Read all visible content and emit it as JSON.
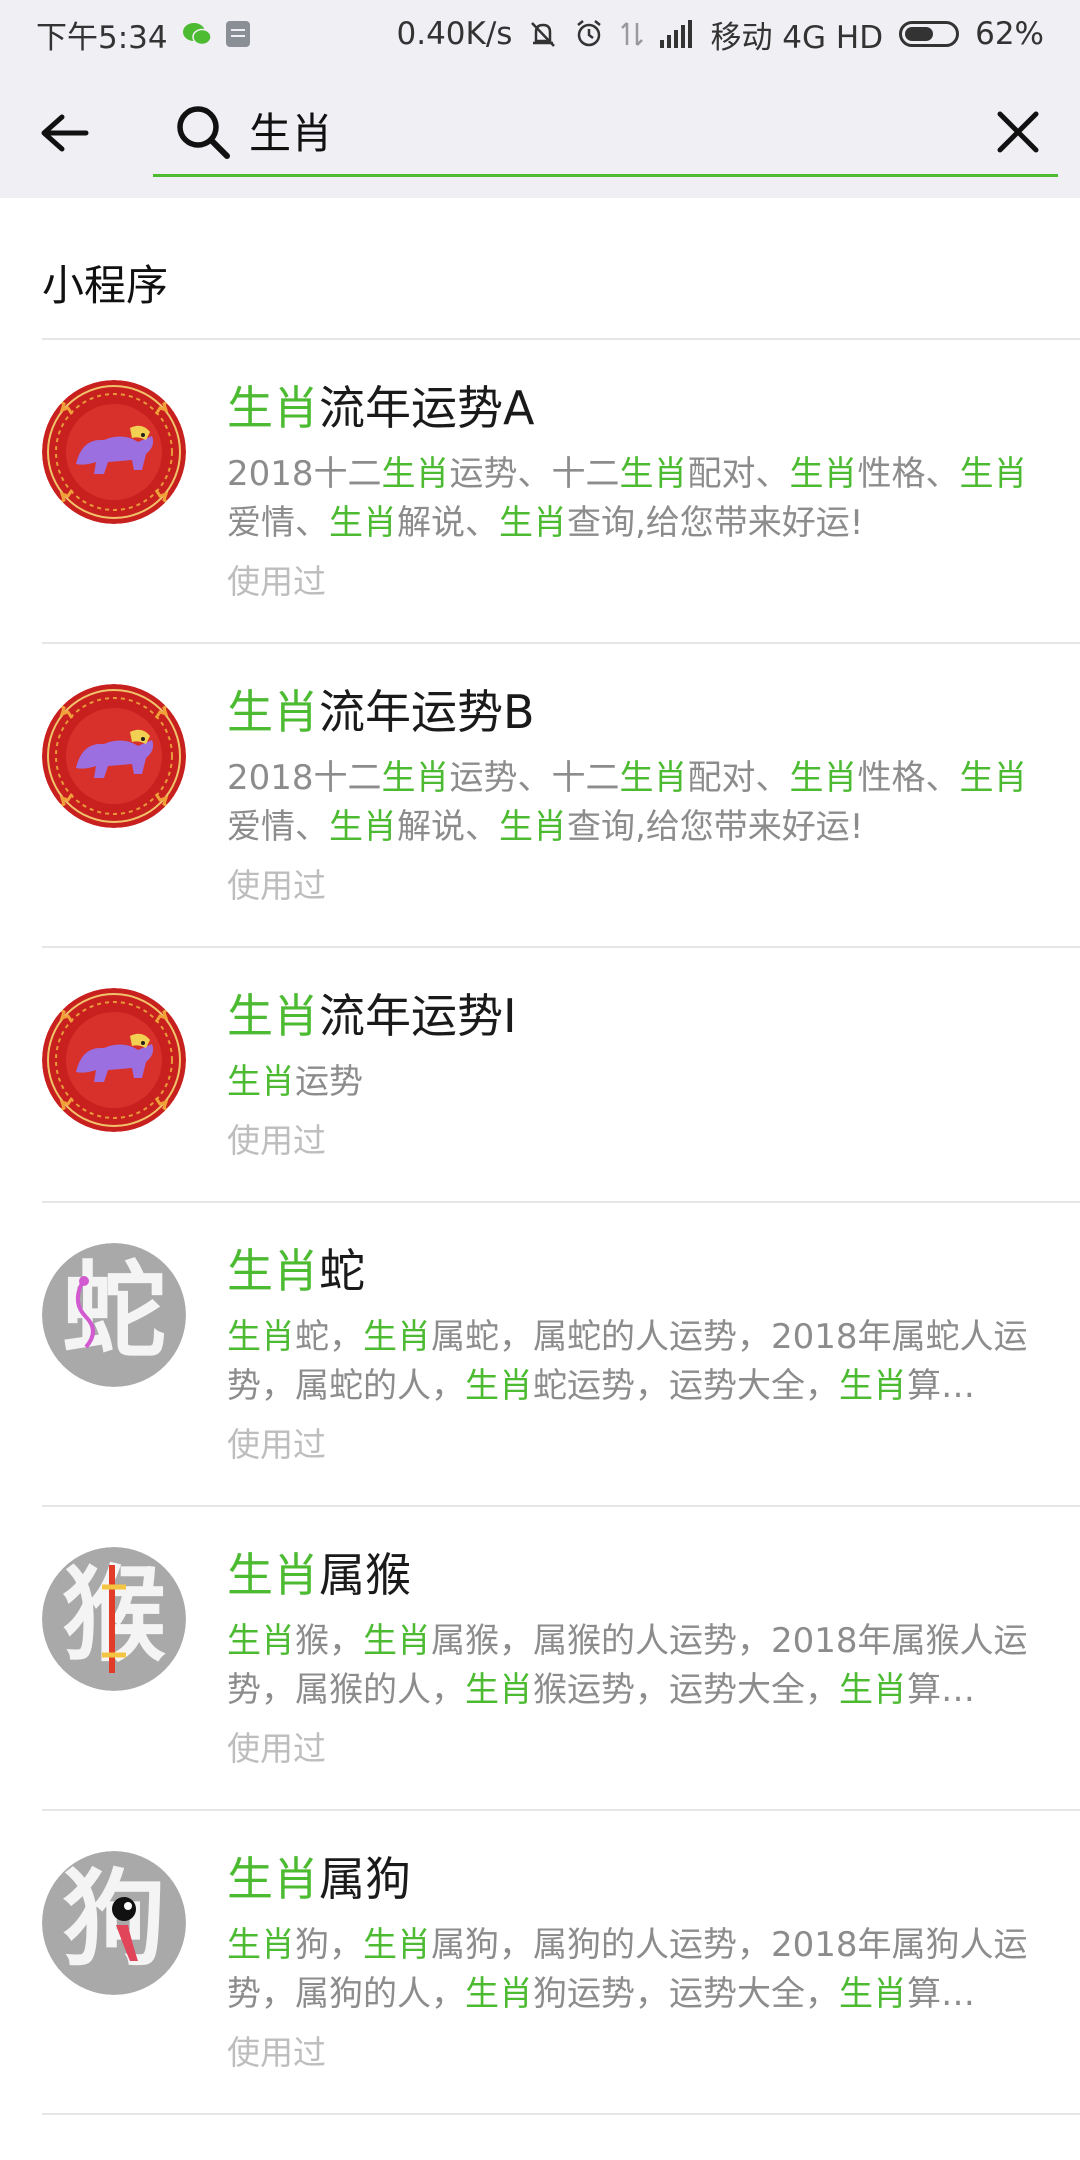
{
  "status_bar": {
    "time": "下午5:34",
    "net_speed": "0.40K/s",
    "carrier": "移动 4G HD",
    "battery_percent": "62%",
    "battery_level": 0.62
  },
  "search": {
    "query": "生肖",
    "placeholder": ""
  },
  "section": {
    "title": "小程序"
  },
  "used_label": "使用过",
  "colors": {
    "highlight": "#4cbb32",
    "accent": "#4cbb32"
  },
  "results": [
    {
      "icon": "zodiac-dog-red-icon",
      "title": [
        [
          "生肖",
          true
        ],
        [
          "流年运势A",
          false
        ]
      ],
      "desc": [
        [
          "2018十二",
          false
        ],
        [
          "生肖",
          true
        ],
        [
          "运势、十二",
          false
        ],
        [
          "生肖",
          true
        ],
        [
          "配对、",
          false
        ],
        [
          "生肖",
          true
        ],
        [
          "性格、",
          false
        ],
        [
          "生肖",
          true
        ],
        [
          "爱情、",
          false
        ],
        [
          "生肖",
          true
        ],
        [
          "解说、",
          false
        ],
        [
          "生肖",
          true
        ],
        [
          "查询,给您带来好运!",
          false
        ]
      ],
      "used": true
    },
    {
      "icon": "zodiac-dog-red-icon",
      "title": [
        [
          "生肖",
          true
        ],
        [
          "流年运势B",
          false
        ]
      ],
      "desc": [
        [
          "2018十二",
          false
        ],
        [
          "生肖",
          true
        ],
        [
          "运势、十二",
          false
        ],
        [
          "生肖",
          true
        ],
        [
          "配对、",
          false
        ],
        [
          "生肖",
          true
        ],
        [
          "性格、",
          false
        ],
        [
          "生肖",
          true
        ],
        [
          "爱情、",
          false
        ],
        [
          "生肖",
          true
        ],
        [
          "解说、",
          false
        ],
        [
          "生肖",
          true
        ],
        [
          "查询,给您带来好运!",
          false
        ]
      ],
      "used": true
    },
    {
      "icon": "zodiac-dog-red-icon",
      "title": [
        [
          "生肖",
          true
        ],
        [
          "流年运势I",
          false
        ]
      ],
      "desc": [
        [
          "生肖",
          true
        ],
        [
          "运势",
          false
        ]
      ],
      "used": true
    },
    {
      "icon": "snake-character-icon",
      "glyph": "蛇",
      "title": [
        [
          "生肖",
          true
        ],
        [
          "蛇",
          false
        ]
      ],
      "desc": [
        [
          "生肖",
          true
        ],
        [
          "蛇，",
          false
        ],
        [
          "生肖",
          true
        ],
        [
          "属蛇，属蛇的人运势，2018年属蛇人运势，属蛇的人，",
          false
        ],
        [
          "生肖",
          true
        ],
        [
          "蛇运势，运势大全，",
          false
        ],
        [
          "生肖",
          true
        ],
        [
          "算命，...",
          false
        ]
      ],
      "used": true
    },
    {
      "icon": "monkey-character-icon",
      "glyph": "猴",
      "title": [
        [
          "生肖",
          true
        ],
        [
          "属猴",
          false
        ]
      ],
      "desc": [
        [
          "生肖",
          true
        ],
        [
          "猴，",
          false
        ],
        [
          "生肖",
          true
        ],
        [
          "属猴，属猴的人运势，2018年属猴人运势，属猴的人，",
          false
        ],
        [
          "生肖",
          true
        ],
        [
          "猴运势，运势大全，",
          false
        ],
        [
          "生肖",
          true
        ],
        [
          "算命，...",
          false
        ]
      ],
      "used": true
    },
    {
      "icon": "dog-character-icon",
      "glyph": "狗",
      "title": [
        [
          "生肖",
          true
        ],
        [
          "属狗",
          false
        ]
      ],
      "desc": [
        [
          "生肖",
          true
        ],
        [
          "狗，",
          false
        ],
        [
          "生肖",
          true
        ],
        [
          "属狗，属狗的人运势，2018年属狗人运势，属狗的人，",
          false
        ],
        [
          "生肖",
          true
        ],
        [
          "狗运势，运势大全，",
          false
        ],
        [
          "生肖",
          true
        ],
        [
          "算命，...",
          false
        ]
      ],
      "used": true
    }
  ]
}
